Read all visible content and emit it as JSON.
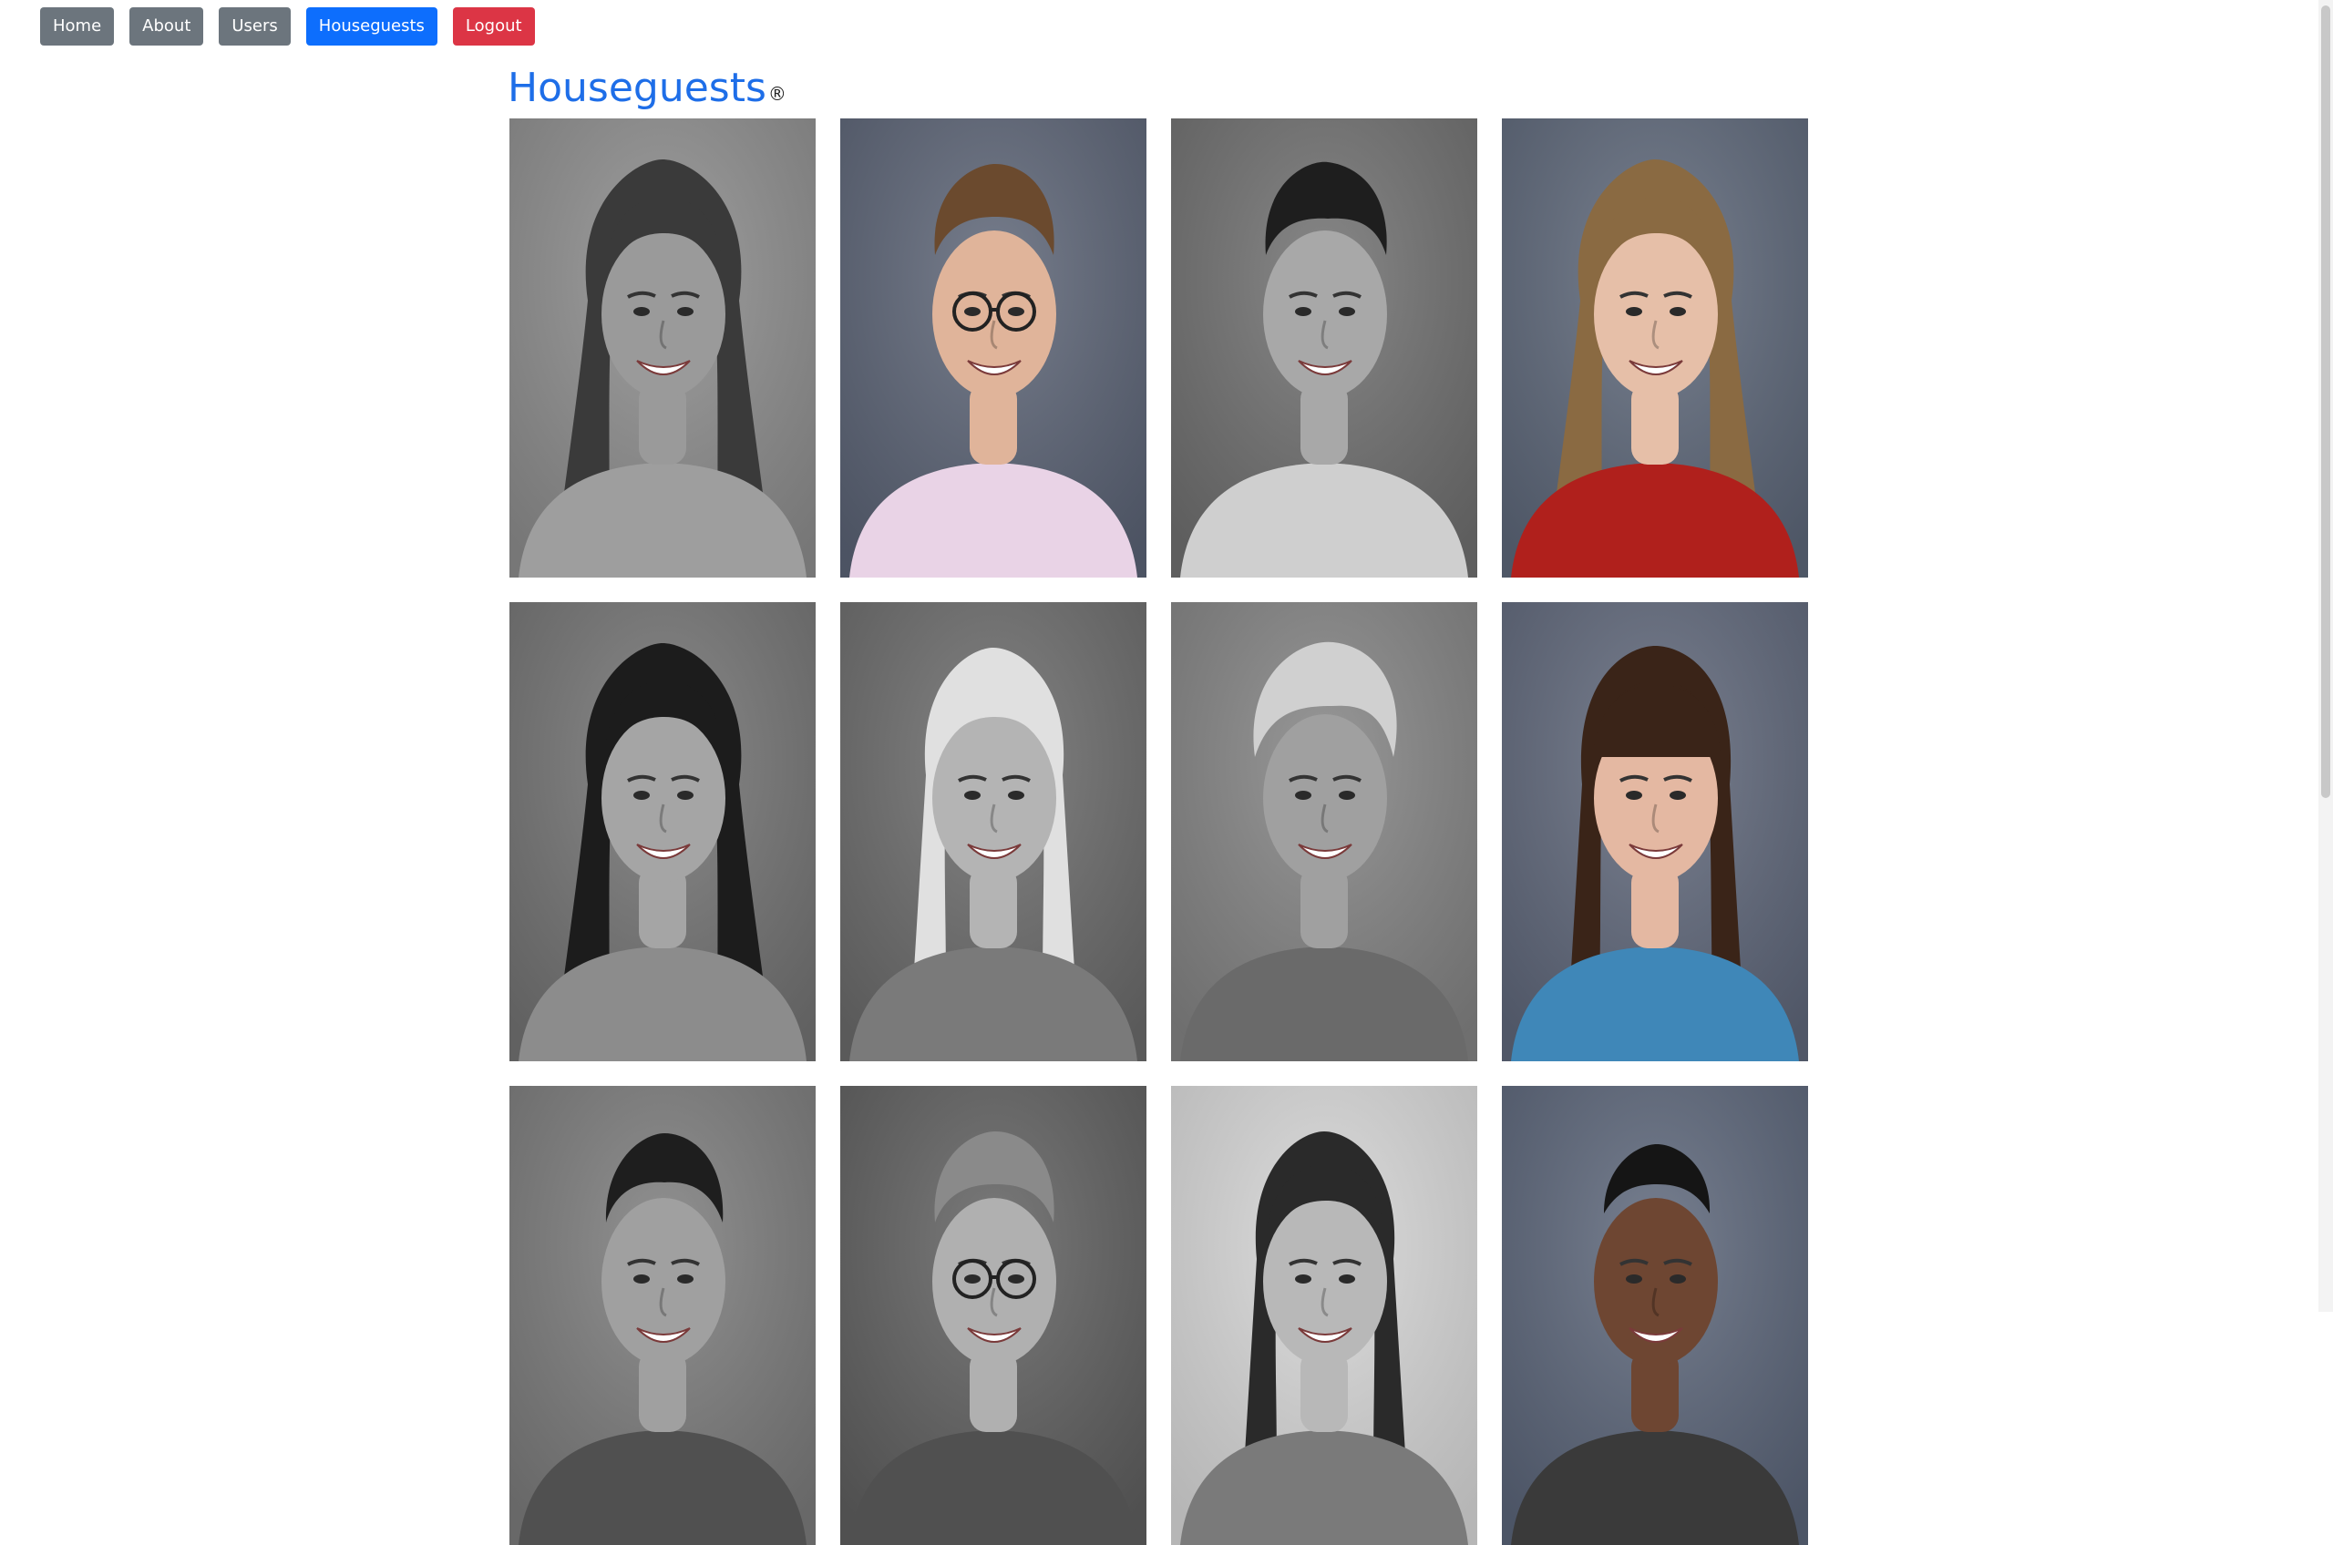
{
  "nav": {
    "home": "Home",
    "about": "About",
    "users": "Users",
    "houseguests": "Houseguests",
    "logout": "Logout"
  },
  "page": {
    "title": "Houseguests",
    "title_mark": "®"
  },
  "colors": {
    "title": "#1e6ee8",
    "nav_default": "#6c757d",
    "nav_active": "#0d6efd",
    "nav_logout": "#dc3545"
  },
  "houseguests": [
    {
      "tone": "bw",
      "hair": "long-wavy",
      "hair_color": "#3a3a3a",
      "skin": "#9a9a9a",
      "bg": "#8c8c8c",
      "top": "#9e9e9e",
      "glasses": false
    },
    {
      "tone": "color",
      "hair": "short",
      "hair_color": "#6b4a2e",
      "skin": "#e0b49a",
      "bg": "#5a6274",
      "top": "#e9d3e6",
      "glasses": true
    },
    {
      "tone": "bw",
      "hair": "short-curly",
      "hair_color": "#1e1e1e",
      "skin": "#a8a8a8",
      "bg": "#6e6e6e",
      "top": "#cfcfcf",
      "glasses": false
    },
    {
      "tone": "color",
      "hair": "long-wavy",
      "hair_color": "#8a6a42",
      "skin": "#e6bfa8",
      "bg": "#5c6678",
      "top": "#b0201c",
      "glasses": false
    },
    {
      "tone": "bw",
      "hair": "long-wavy",
      "hair_color": "#1c1c1c",
      "skin": "#a5a5a5",
      "bg": "#727272",
      "top": "#8c8c8c",
      "glasses": false
    },
    {
      "tone": "bw",
      "hair": "long-straight",
      "hair_color": "#e0e0e0",
      "skin": "#b4b4b4",
      "bg": "#6a6a6a",
      "top": "#7a7a7a",
      "glasses": false
    },
    {
      "tone": "bw",
      "hair": "short-messy",
      "hair_color": "#d0d0d0",
      "skin": "#a0a0a0",
      "bg": "#828282",
      "top": "#6a6a6a",
      "glasses": false
    },
    {
      "tone": "color",
      "hair": "bangs",
      "hair_color": "#3a2418",
      "skin": "#e4b8a2",
      "bg": "#5e6679",
      "top": "#3f87b8",
      "glasses": false
    },
    {
      "tone": "bw",
      "hair": "slick",
      "hair_color": "#1e1e1e",
      "skin": "#a0a0a0",
      "bg": "#7a7a7a",
      "top": "#505050",
      "glasses": false
    },
    {
      "tone": "bw",
      "hair": "short",
      "hair_color": "#8a8a8a",
      "skin": "#b0b0b0",
      "bg": "#5e5e5e",
      "top": "#505050",
      "glasses": true
    },
    {
      "tone": "bw",
      "hair": "long-straight",
      "hair_color": "#2a2a2a",
      "skin": "#b8b8b8",
      "bg": "#d6d6d6",
      "top": "#7a7a7a",
      "glasses": false
    },
    {
      "tone": "color",
      "hair": "buzz",
      "hair_color": "#151515",
      "skin": "#6e4632",
      "bg": "#5a6478",
      "top": "#3a3a3a",
      "glasses": false
    }
  ]
}
